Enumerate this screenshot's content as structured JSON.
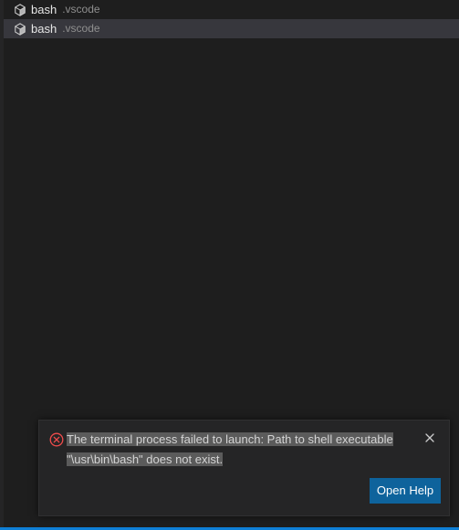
{
  "terminal_list": {
    "items": [
      {
        "name": "bash",
        "description": ".vscode",
        "selected": false
      },
      {
        "name": "bash",
        "description": ".vscode",
        "selected": true
      }
    ]
  },
  "notification": {
    "severity": "error",
    "line1": "The terminal process failed to launch: Path to shell executable",
    "line2": "\"\\usr\\bin\\bash\" does not exist.",
    "action_label": "Open Help",
    "close_icon": "close-icon",
    "error_icon": "error-circle-icon"
  },
  "colors": {
    "background": "#1e1e1e",
    "selected_row": "#37373d",
    "toast_bg": "#252526",
    "error": "#f14c4c",
    "button": "#0e639c",
    "status_bar": "#0e7fd6"
  }
}
